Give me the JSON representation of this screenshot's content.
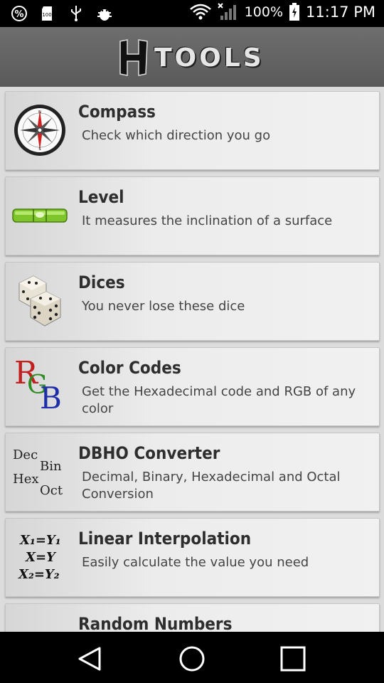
{
  "status": {
    "battery": "100%",
    "time": "11:17 PM"
  },
  "app": {
    "brand": "TOOLS"
  },
  "items": [
    {
      "title": "Compass",
      "desc": "Check which direction you go",
      "icon": "compass-icon"
    },
    {
      "title": "Level",
      "desc": "It measures the inclination of a surface",
      "icon": "level-icon"
    },
    {
      "title": "Dices",
      "desc": "You never lose these dice",
      "icon": "dice-icon"
    },
    {
      "title": "Color Codes",
      "desc": "Get the Hexadecimal code and RGB of any color",
      "icon": "rgb-icon"
    },
    {
      "title": "DBHO Converter",
      "desc": "Decimal, Binary, Hexadecimal and Octal Conversion",
      "icon": "dbho-icon"
    },
    {
      "title": "Linear Interpolation",
      "desc": "Easily calculate the value you need",
      "icon": "interpolation-icon"
    },
    {
      "title": "Random Numbers",
      "desc": "",
      "icon": "random-icon"
    }
  ],
  "icon_text": {
    "rgb": [
      "R",
      "G",
      "B"
    ],
    "dbho": [
      "Dec",
      "Bin",
      "Hex",
      "Oct"
    ],
    "interp": [
      "X₁=Y₁",
      "X=Y",
      "X₂=Y₂"
    ]
  },
  "colors": {
    "status_bg": "#000000",
    "appbar_bg": "#666666",
    "card_bg": "#eeeeee",
    "title_text": "#2e2e2e"
  }
}
